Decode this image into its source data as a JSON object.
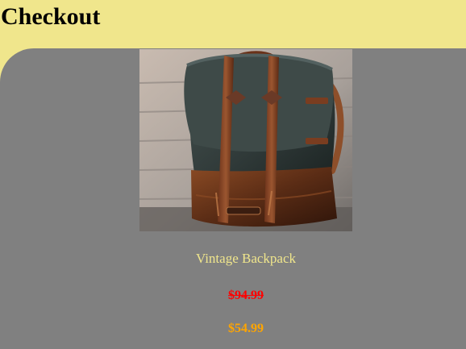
{
  "page": {
    "title": "Checkout"
  },
  "product": {
    "name": "Vintage Backpack",
    "original_price": "$94.99",
    "sale_price": "$54.99",
    "image_alt": "Vintage Backpack"
  },
  "colors": {
    "header_background": "#f0e68c",
    "panel_background": "#808080",
    "product_name": "#f0e68c",
    "original_price": "#ff0000",
    "sale_price": "#ffa500"
  }
}
